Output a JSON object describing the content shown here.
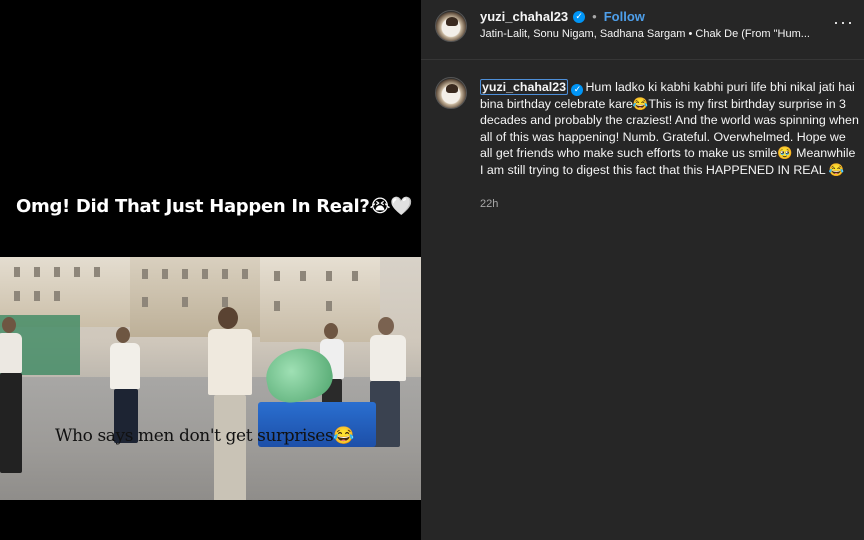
{
  "media": {
    "caption": "Omg! Did That Just Happen In Real?😭🤍",
    "video_text": "Who says men don't get surprises😂"
  },
  "post": {
    "username": "yuzi_chahal23",
    "follow_label": "Follow",
    "separator": "•",
    "audio": "Jatin-Lalit, Sonu Nigam, Sadhana Sargam • Chak De (From \"Hum...",
    "more_label": "···",
    "verified_icon": "✓"
  },
  "comment": {
    "username": "yuzi_chahal23",
    "text": "Hum ladko ki kabhi kabhi puri life bhi nikal jati hai bina birthday celebrate kare😂This is my first birthday surprise in 3 decades and probably the craziest! And the world was spinning when all of this was happening! Numb. Grateful. Overwhelmed. Hope we all get friends who make such efforts to make us smile🥹 Meanwhile I am still trying to digest this fact that this HAPPENED IN REAL 😂",
    "time": "22h"
  },
  "colors": {
    "panel_bg": "#262626",
    "follow": "#4e9fea",
    "verified": "#0095f6",
    "muted": "#a8a8a8"
  }
}
